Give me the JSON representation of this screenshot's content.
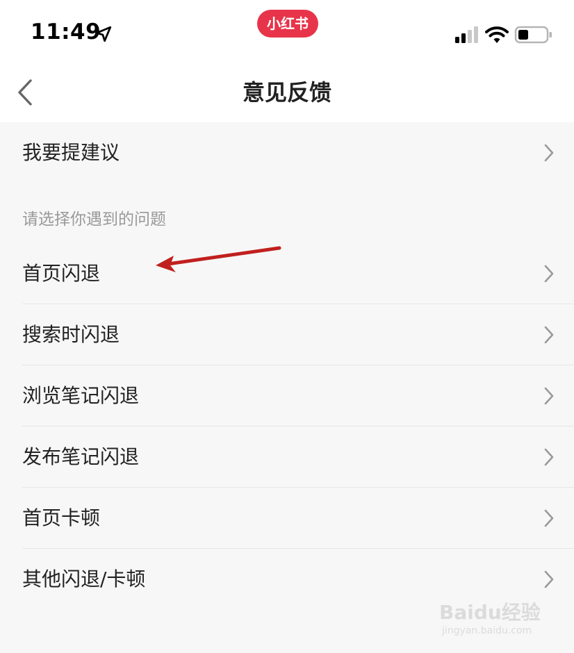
{
  "status_bar": {
    "time": "11:49",
    "app_badge": "小红书",
    "badge_color": "#e8344a"
  },
  "nav": {
    "title": "意见反馈",
    "back_icon": "chevron-left-icon"
  },
  "top_item": {
    "label": "我要提建议"
  },
  "section": {
    "header": "请选择你遇到的问题",
    "items": [
      {
        "label": "首页闪退"
      },
      {
        "label": "搜索时闪退"
      },
      {
        "label": "浏览笔记闪退"
      },
      {
        "label": "发布笔记闪退"
      },
      {
        "label": "首页卡顿"
      },
      {
        "label": "其他闪退/卡顿"
      }
    ]
  },
  "annotation": {
    "arrow_color": "#c0201e"
  },
  "watermark": {
    "main": "Baidu经验",
    "sub": "jingyan.baidu.com"
  }
}
